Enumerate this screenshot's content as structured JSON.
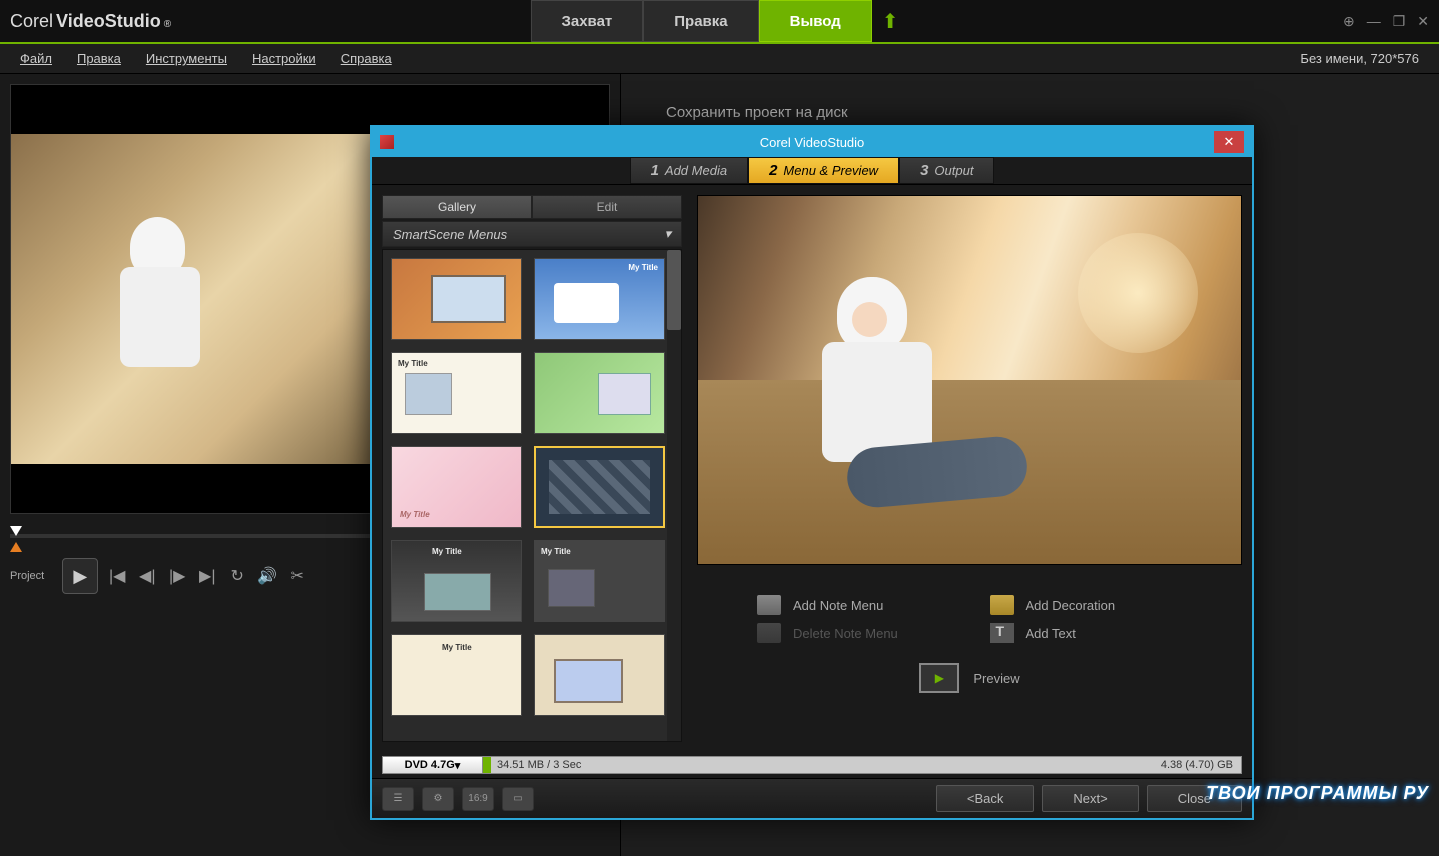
{
  "app": {
    "logo_corel": "Corel",
    "logo_video": "VideoStudio",
    "reg": "®"
  },
  "mainTabs": {
    "capture": "Захват",
    "edit": "Правка",
    "output": "Вывод"
  },
  "menu": {
    "file": "Файл",
    "edit": "Правка",
    "tools": "Инструменты",
    "settings": "Настройки",
    "help": "Справка"
  },
  "projectInfo": "Без имени, 720*576",
  "player": {
    "label": "Project"
  },
  "rightPanel": {
    "saveHeader": "Сохранить проект на диск"
  },
  "dialog": {
    "title": "Corel VideoStudio",
    "steps": {
      "s1": "Add Media",
      "s2": "Menu & Preview",
      "s3": "Output",
      "n1": "1",
      "n2": "2",
      "n3": "3"
    },
    "galleryTabs": {
      "gallery": "Gallery",
      "edit": "Edit"
    },
    "dropdown": "SmartScene Menus",
    "actions": {
      "addNote": "Add Note Menu",
      "deleteNote": "Delete Note Menu",
      "addDecoration": "Add Decoration",
      "addText": "Add Text",
      "preview": "Preview"
    },
    "progress": {
      "disc": "DVD 4.7G",
      "used": "34.51 MB / 3 Sec",
      "total": "4.38 (4.70) GB"
    },
    "footer": {
      "ratio": "16:9",
      "back": "<Back",
      "next": "Next>",
      "close": "Close"
    }
  },
  "thumbLabels": {
    "myTitle": "My Title"
  },
  "watermark": "ТВОИ ПРОГРАММЫ РУ"
}
